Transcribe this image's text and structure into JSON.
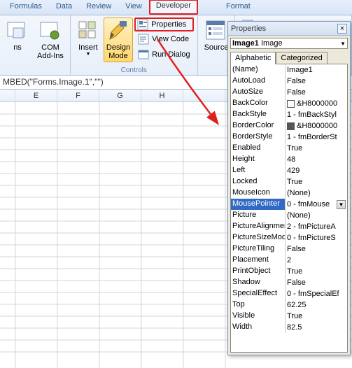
{
  "ribbon": {
    "tabs": [
      "Formulas",
      "Data",
      "Review",
      "View",
      "Developer",
      "Format"
    ],
    "active_tab": "Developer",
    "groups": {
      "addins": {
        "label": "",
        "btn_ins": "ns",
        "btn_com": "COM\nAdd-Ins"
      },
      "controls": {
        "label": "Controls",
        "insert": "Insert",
        "design": "Design\nMode",
        "properties": "Properties",
        "view_code": "View Code",
        "run_dialog": "Run Dialog"
      },
      "xml": {
        "source": "Source"
      }
    }
  },
  "formula_bar": "MBED(\"Forms.Image.1\",\"\")",
  "columns": [
    "E",
    "F",
    "G",
    "H"
  ],
  "properties_panel": {
    "title": "Properties",
    "object_name": "Image1",
    "object_type": "Image",
    "tabs": [
      "Alphabetic",
      "Categorized"
    ],
    "active_tab": "Alphabetic",
    "selected_row": "MousePointer",
    "rows": [
      {
        "name": "(Name)",
        "value": "Image1"
      },
      {
        "name": "AutoLoad",
        "value": "False"
      },
      {
        "name": "AutoSize",
        "value": "False"
      },
      {
        "name": "BackColor",
        "value": "&H8000000",
        "swatch": "#ffffff"
      },
      {
        "name": "BackStyle",
        "value": "1 - fmBackStyl"
      },
      {
        "name": "BorderColor",
        "value": "&H8000000",
        "swatch": "#555555"
      },
      {
        "name": "BorderStyle",
        "value": "1 - fmBorderSt"
      },
      {
        "name": "Enabled",
        "value": "True"
      },
      {
        "name": "Height",
        "value": "48"
      },
      {
        "name": "Left",
        "value": "429"
      },
      {
        "name": "Locked",
        "value": "True"
      },
      {
        "name": "MouseIcon",
        "value": "(None)"
      },
      {
        "name": "MousePointer",
        "value": "0 - fmMouse",
        "dropdown": true
      },
      {
        "name": "Picture",
        "value": "(None)"
      },
      {
        "name": "PictureAlignmen",
        "value": "2 - fmPictureA"
      },
      {
        "name": "PictureSizeMode",
        "value": "0 - fmPictureS"
      },
      {
        "name": "PictureTiling",
        "value": "False"
      },
      {
        "name": "Placement",
        "value": "2"
      },
      {
        "name": "PrintObject",
        "value": "True"
      },
      {
        "name": "Shadow",
        "value": "False"
      },
      {
        "name": "SpecialEffect",
        "value": "0 - fmSpecialEf"
      },
      {
        "name": "Top",
        "value": "62.25"
      },
      {
        "name": "Visible",
        "value": "True"
      },
      {
        "name": "Width",
        "value": "82.5"
      }
    ]
  }
}
